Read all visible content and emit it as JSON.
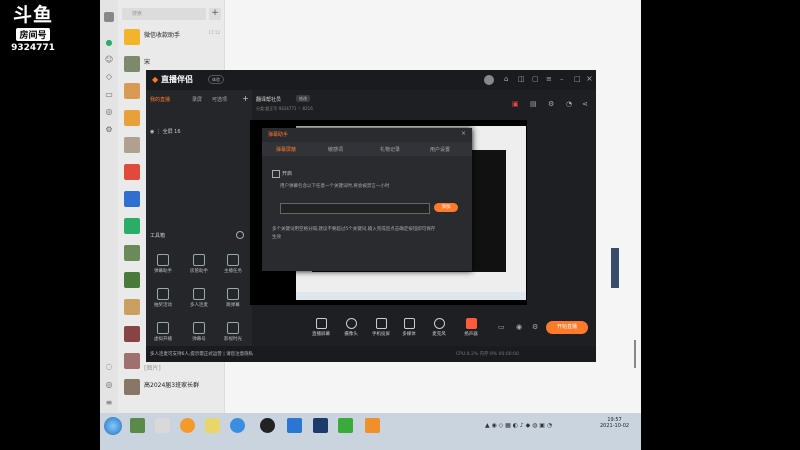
{
  "overlay": {
    "logo_big": "斗鱼",
    "room_label": "房间号",
    "room_number": "9324771"
  },
  "wechat": {
    "search_placeholder": "搜索",
    "plus": "+",
    "chats": [
      {
        "name": "微信收款助手",
        "time": "17:12",
        "sub": ""
      },
      {
        "name": "宋",
        "time": "",
        "sub": ""
      },
      {
        "name": "",
        "time": "",
        "sub": ""
      },
      {
        "name": "",
        "time": "",
        "sub": ""
      },
      {
        "name": "",
        "time": "",
        "sub": ""
      },
      {
        "name": "",
        "time": "",
        "sub": ""
      },
      {
        "name": "",
        "time": "",
        "sub": ""
      },
      {
        "name": "",
        "time": "",
        "sub": ""
      },
      {
        "name": "",
        "time": "",
        "sub": ""
      },
      {
        "name": "",
        "time": "",
        "sub": ""
      },
      {
        "name": "",
        "time": "",
        "sub": ""
      },
      {
        "name": "",
        "time": "",
        "sub": ""
      },
      {
        "name": "",
        "time": "",
        "sub": ""
      },
      {
        "name": "",
        "time": "",
        "sub": ""
      },
      {
        "name": "[图片]",
        "time": "",
        "sub": ""
      },
      {
        "name": "高2024届3班家长群",
        "time": "",
        "sub": ""
      }
    ]
  },
  "app": {
    "logo": "直播伴侣",
    "badge": "体验",
    "tabs": [
      "我的直播",
      "录屏",
      "可选项"
    ],
    "scene": "全屏 16",
    "tool_header": "工具箱",
    "tools": [
      "弹幕助手",
      "房管助手",
      "主播任务",
      "抽奖活动",
      "多人连麦",
      "跳弹幕",
      "虚拟开播",
      "弹幕号",
      "影视时光"
    ],
    "room_title": "翻译帮社员",
    "room_edit": "修改",
    "room_meta": "分类:超正写 9324771  ♡ 8216",
    "bottom": [
      "直播屏幕",
      "摄像头",
      "手机投屏",
      "多媒体",
      "麦克风",
      "扬声器"
    ],
    "live_button": "开始直播",
    "status_text": "多人连麦可支持6人,提示需正式运营 | 请您注意隐私",
    "status_right": "CPU:4.2%  内存:9%  00:00:00"
  },
  "dialog": {
    "title": "弹幕助手",
    "close": "×",
    "tabs": [
      "弹幕屏蔽",
      "敏感词",
      "礼物记录",
      "用户设置"
    ],
    "open_label": "开启",
    "desc": "用户弹幕包含以下任意一个关键词时,将会被禁言一小时",
    "add": "添加",
    "note1": "多个关键词用空格分隔,建议不要超过5个关键词,输入完成后点击确定按钮即可保存",
    "note2": "生效"
  },
  "taskbar": {
    "clock_time": "19:57",
    "clock_date": "2021-10-02"
  }
}
